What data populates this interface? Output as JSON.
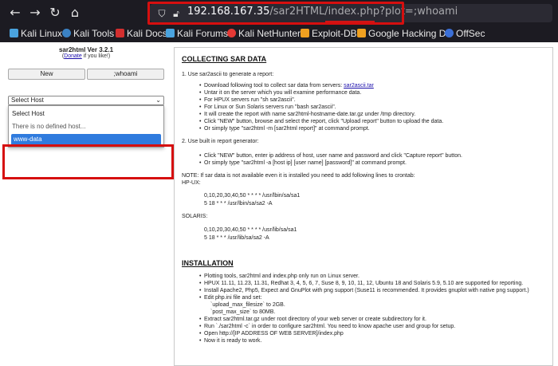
{
  "browser": {
    "url_host": "192.168.167.35",
    "url_path": "/sar2HTML/index.php?plot=",
    "url_param": ";whoami"
  },
  "bookmarks": [
    {
      "label": "Kali Linux",
      "color": "#4aa3df"
    },
    {
      "label": "Kali Tools",
      "color": "#3b82c4"
    },
    {
      "label": "Kali Docs",
      "color": "#d32f2f"
    },
    {
      "label": "Kali Forums",
      "color": "#4aa3df"
    },
    {
      "label": "Kali NetHunter",
      "color": "#e53935"
    },
    {
      "label": "Exploit-DB",
      "color": "#f0a020"
    },
    {
      "label": "Google Hacking DB",
      "color": "#f0a020"
    },
    {
      "label": "OffSec",
      "color": "#3b6fd6"
    }
  ],
  "sidebar": {
    "title": "sar2html Ver 3.2.1",
    "donate_open": "(",
    "donate_link": "Donate",
    "donate_rest": " if you like!)",
    "btn_new": "New",
    "btn_cmd": ";whoami",
    "select_value": "Select Host",
    "options": [
      "Select Host",
      "There is no defined host...",
      "www-data"
    ]
  },
  "content": {
    "heading1": "COLLECTING SAR DATA",
    "step1": "1. Use sar2ascii to generate a report:",
    "bullets1": [
      "Download following tool to collect sar data from servers: ",
      "Untar it on the server which you will examine performance data.",
      "For HPUX servers run \"sh sar2ascii\".",
      "For Linux or Sun Solaris servers run \"bash sar2ascii\".",
      "It will create the report with name sar2html-hostname-date.tar.gz under /tmp directory.",
      "Click \"NEW\" button, browse and select the report, click \"Upload report\" button to upload the data.",
      "Or simply type \"sar2html -m [sar2html report]\" at command prompt."
    ],
    "bullet1_link": "sar2ascii.tar",
    "step2": "2. Use built in report generator:",
    "bullets2": [
      "Click \"NEW\" button, enter ip address of host, user name and password and click \"Capture report\" button.",
      "Or simply type \"sar2html -a [host ip] [user name] [password]\" at command prompt."
    ],
    "note": "NOTE: If sar data is not available even it is installed you need to add following lines to crontab:",
    "hpux": "HP-UX:",
    "hpux_lines": [
      "0,10,20,30,40,50 * * * * /usr/lbin/sa/sa1",
      "5 18 * * * /usr/lbin/sa/sa2 -A"
    ],
    "solaris": "SOLARIS:",
    "solaris_lines": [
      "0,10,20,30,40,50 * * * * /usr/lib/sa/sa1",
      "5 18 * * * /usr/lib/sa/sa2 -A"
    ],
    "heading2": "INSTALLATION",
    "install": [
      "Plotting tools, sar2html and index.php only run on Linux server.",
      "HPUX 11.11, 11.23, 11.31, Redhat 3, 4, 5, 6, 7, Suse 8, 9, 10, 11, 12, Ubuntu 18 and Solaris 5.9, 5.10 are supported for reporting.",
      "Install Apache2, Php5, Expect and GnuPlot with png support (Suse11 is recommended. It provides gnuplot with native png support.)",
      "Edit php.ini file and set:",
      "Extract sar2html.tar.gz under root directory of your web server or create subdirectory for it.",
      "Run `./sar2html -c` in order to configure sar2html. You need to know apache user and group for setup.",
      "Open http://[IP ADDRESS OF WEB SERVER]/index.php",
      "Now it is ready to work."
    ],
    "php_settings": [
      "`upload_max_filesize` to 2GB.",
      "`post_max_size` to 80MB."
    ]
  }
}
